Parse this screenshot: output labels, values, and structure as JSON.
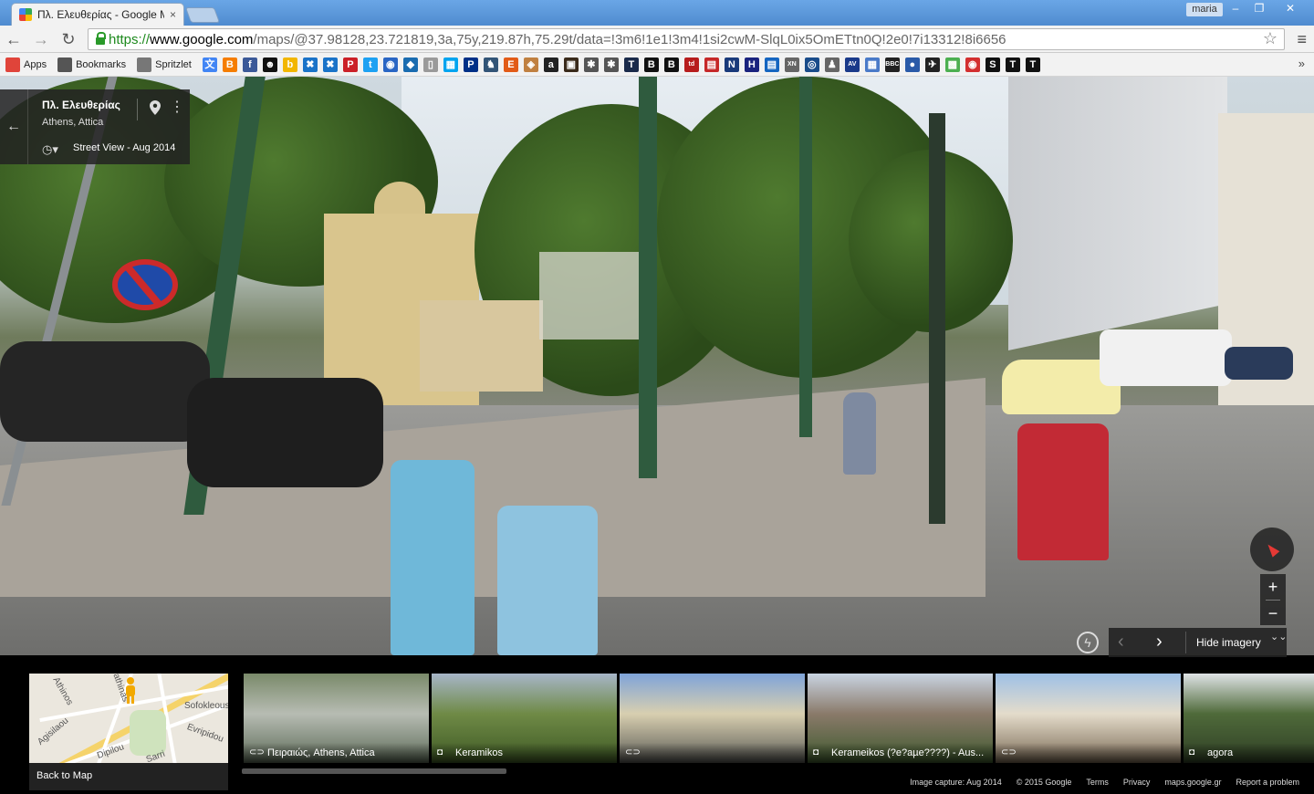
{
  "browser": {
    "tab_title": "Πλ. Ελευθερίας - Google Map",
    "tab_close": "×",
    "user": "maria",
    "window_buttons": [
      "–",
      "❐",
      "✕"
    ],
    "url_scheme": "https://",
    "url_host": "www.google.com",
    "url_rest": "/maps/@37.98128,23.721819,3a,75y,219.87h,75.29t/data=!3m6!1e1!3m4!1si2cwM-SlqL0ix5OmETtn0Q!2e0!7i13312!8i6656",
    "back": "←",
    "forward": "→",
    "reload": "↻",
    "star": "☆",
    "menu": "≡",
    "bookmarks_named": [
      {
        "label": "Apps",
        "icon": "apps-grid-icon",
        "color": "#e0443a"
      },
      {
        "label": "Bookmarks",
        "icon": "star-icon",
        "color": "#555555"
      },
      {
        "label": "Spritzlet",
        "icon": "page-icon",
        "color": "#777777"
      }
    ],
    "bookmark_icons": [
      {
        "name": "translate-icon",
        "glyph": "文",
        "color": "#4285f4"
      },
      {
        "name": "blogger-icon",
        "glyph": "B",
        "color": "#f57d00"
      },
      {
        "name": "facebook-icon",
        "glyph": "f",
        "color": "#3b5998"
      },
      {
        "name": "smiley-icon",
        "glyph": "☻",
        "color": "#111111"
      },
      {
        "name": "bing-icon",
        "glyph": "b",
        "color": "#f2b600"
      },
      {
        "name": "cross-icon",
        "glyph": "✖",
        "color": "#1a73c8"
      },
      {
        "name": "cross2-icon",
        "glyph": "✖",
        "color": "#1a73c8"
      },
      {
        "name": "pinterest-icon",
        "glyph": "P",
        "color": "#cb2027"
      },
      {
        "name": "twitter-icon",
        "glyph": "t",
        "color": "#1da1f2"
      },
      {
        "name": "globe-icon",
        "glyph": "◉",
        "color": "#2a66c4"
      },
      {
        "name": "cube-icon",
        "glyph": "◆",
        "color": "#1a6cb0"
      },
      {
        "name": "page2-icon",
        "glyph": "▯",
        "color": "#9a9a9a"
      },
      {
        "name": "windows-icon",
        "glyph": "▦",
        "color": "#00a4ef"
      },
      {
        "name": "paypal-icon",
        "glyph": "P",
        "color": "#003087"
      },
      {
        "name": "knight-icon",
        "glyph": "♞",
        "color": "#335577"
      },
      {
        "name": "e-icon",
        "glyph": "E",
        "color": "#e25b17"
      },
      {
        "name": "tag-icon",
        "glyph": "◈",
        "color": "#c08040"
      },
      {
        "name": "amazon-icon",
        "glyph": "a",
        "color": "#222222"
      },
      {
        "name": "briefcase-icon",
        "glyph": "▣",
        "color": "#3a2a1a"
      },
      {
        "name": "wrench-icon",
        "glyph": "✱",
        "color": "#555555"
      },
      {
        "name": "wrench2-icon",
        "glyph": "✱",
        "color": "#555555"
      },
      {
        "name": "toc-icon",
        "glyph": "T",
        "color": "#1a2a4a"
      },
      {
        "name": "b-bold-icon",
        "glyph": "B",
        "color": "#111111"
      },
      {
        "name": "b-bold2-icon",
        "glyph": "B",
        "color": "#111111"
      },
      {
        "name": "td-icon",
        "glyph": "td",
        "color": "#b71c1c"
      },
      {
        "name": "news-icon",
        "glyph": "▤",
        "color": "#c62828"
      },
      {
        "name": "n-icon",
        "glyph": "N",
        "color": "#1a3a7a"
      },
      {
        "name": "h-icon",
        "glyph": "H",
        "color": "#1a237e"
      },
      {
        "name": "news2-icon",
        "glyph": "▤",
        "color": "#1565c0"
      },
      {
        "name": "xn-icon",
        "glyph": "XN",
        "color": "#666666"
      },
      {
        "name": "circle-logo-icon",
        "glyph": "◎",
        "color": "#1a4c8a"
      },
      {
        "name": "figure-icon",
        "glyph": "♟",
        "color": "#666666"
      },
      {
        "name": "av-icon",
        "glyph": "AV",
        "color": "#1a3a8a"
      },
      {
        "name": "grid-logo-icon",
        "glyph": "▦",
        "color": "#4a7ac8"
      },
      {
        "name": "bbc-icon",
        "glyph": "BBC",
        "color": "#222222"
      },
      {
        "name": "round-logo-icon",
        "glyph": "●",
        "color": "#2a5aa8"
      },
      {
        "name": "bird-icon",
        "glyph": "✈",
        "color": "#222222"
      },
      {
        "name": "squares-icon",
        "glyph": "▩",
        "color": "#4caf50"
      },
      {
        "name": "red-disc-icon",
        "glyph": "◉",
        "color": "#d32f2f"
      },
      {
        "name": "s-icon",
        "glyph": "S",
        "color": "#111111"
      },
      {
        "name": "nyt-icon",
        "glyph": "T",
        "color": "#111111"
      },
      {
        "name": "nyt2-icon",
        "glyph": "T",
        "color": "#111111"
      }
    ],
    "bookmarks_more": "»"
  },
  "info_card": {
    "back": "←",
    "title": "Πλ. Ελευθερίας",
    "subtitle": "Athens, Attica",
    "history_icon": "◷▾",
    "date_label": "Street View - Aug 2014",
    "more": "⋮"
  },
  "controls": {
    "zoom_in": "+",
    "zoom_out": "−",
    "flash": "ϟ",
    "prev": "‹",
    "next": "›",
    "hide_imagery": "Hide imagery",
    "hide_chevrons": "⌄⌄"
  },
  "minimap": {
    "labels": [
      "Sofokleous",
      "Evripidou",
      "Agisilaou",
      "athinas",
      "Dipilou",
      "Sarri",
      "Athinos"
    ],
    "back_to_map": "Back to Map"
  },
  "thumbnails": [
    {
      "label": "Πειραιώς, Athens, Attica",
      "icon": "panorama-icon",
      "glyph": "⊂⊃",
      "colors": [
        "#7a8a6a",
        "#b7bcb3",
        "#5d6b58"
      ]
    },
    {
      "label": "Keramikos",
      "icon": "camera-icon",
      "glyph": "◘",
      "colors": [
        "#a7b6c8",
        "#6f8a46",
        "#3f5a25"
      ]
    },
    {
      "label": "",
      "icon": "panorama-icon",
      "glyph": "⊂⊃",
      "colors": [
        "#7fa3d9",
        "#d8cfb0",
        "#5a5a55"
      ]
    },
    {
      "label": "Kerameikos (?e?aµe????) - Aus...",
      "icon": "camera-icon",
      "glyph": "◘",
      "colors": [
        "#c9d4e2",
        "#8a7a6a",
        "#3f5a2e"
      ]
    },
    {
      "label": "",
      "icon": "panorama-icon",
      "glyph": "⊂⊃",
      "colors": [
        "#9ec0e6",
        "#e4dccb",
        "#7a6a55"
      ]
    },
    {
      "label": "agora",
      "icon": "camera-icon",
      "glyph": "◘",
      "colors": [
        "#dfe3e6",
        "#4f6a3a",
        "#2f3f25"
      ]
    }
  ],
  "footer": [
    "Image capture: Aug 2014",
    "© 2015 Google",
    "Terms",
    "Privacy",
    "maps.google.gr",
    "Report a problem"
  ]
}
